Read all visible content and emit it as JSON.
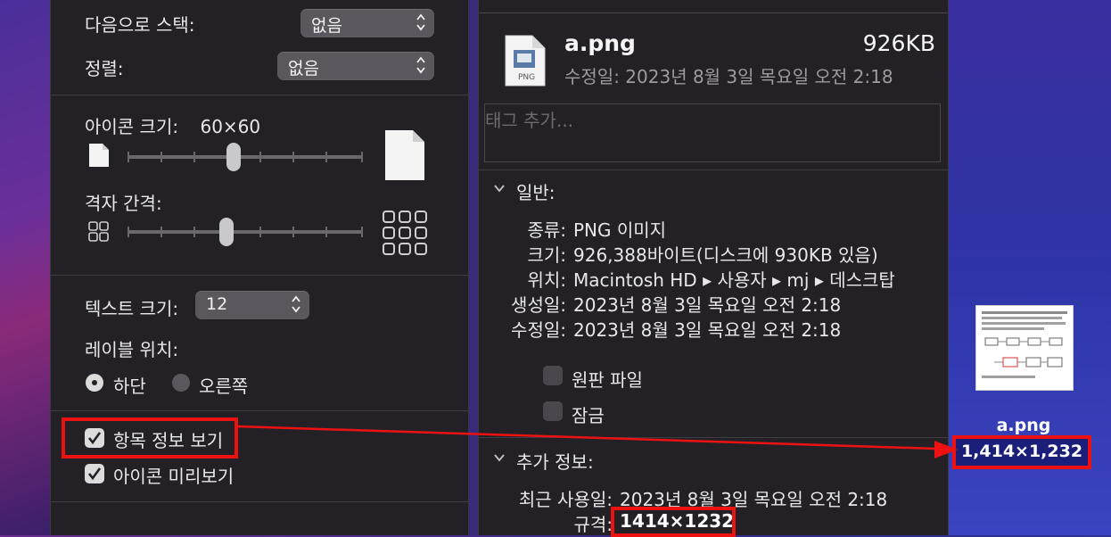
{
  "left": {
    "stack_label": "다음으로 스택:",
    "stack_value": "없음",
    "sort_label": "정렬:",
    "sort_value": "없음",
    "icon_size_label": "아이콘 크기:",
    "icon_size_value": "60×60",
    "grid_spacing_label": "격자 간격:",
    "text_size_label": "텍스트 크기:",
    "text_size_value": "12",
    "label_position_label": "레이블 위치:",
    "label_bottom": "하단",
    "label_right": "오른쪽",
    "show_item_info": "항목 정보 보기",
    "show_icon_preview": "아이콘 미리보기",
    "icon_size_slider": 0.45,
    "grid_spacing_slider": 0.42
  },
  "right": {
    "file_name": "a.png",
    "file_size": "926KB",
    "file_icon_label": "PNG",
    "modified_header": "수정일: 2023년 8월 3일 목요일 오전 2:18",
    "tags_placeholder": "태그 추가...",
    "general_title": "일반:",
    "kind_label": "종류:",
    "kind_value": "PNG 이미지",
    "size_label": "크기:",
    "size_value": "926,388바이트(디스크에 930KB 있음)",
    "where_label": "위치:",
    "where_value": "Macintosh HD ▸ 사용자 ▸ mj ▸ 데스크탑",
    "created_label": "생성일:",
    "created_value": "2023년 8월 3일 목요일 오전 2:18",
    "modified_label": "수정일:",
    "modified_value": "2023년 8월 3일 목요일 오전 2:18",
    "stationery_label": "원판 파일",
    "locked_label": "잠금",
    "more_info_title": "추가 정보:",
    "last_opened_label": "최근 사용일:",
    "last_opened_value": "2023년 8월 3일 목요일 오전 2:18",
    "dimensions_label": "규격:",
    "dimensions_value": "1414×1232"
  },
  "desktop": {
    "file_name": "a.png",
    "file_dimensions": "1,414×1,232"
  },
  "colors": {
    "panel_bg": "#232126",
    "annotation_red": "#e11111"
  }
}
